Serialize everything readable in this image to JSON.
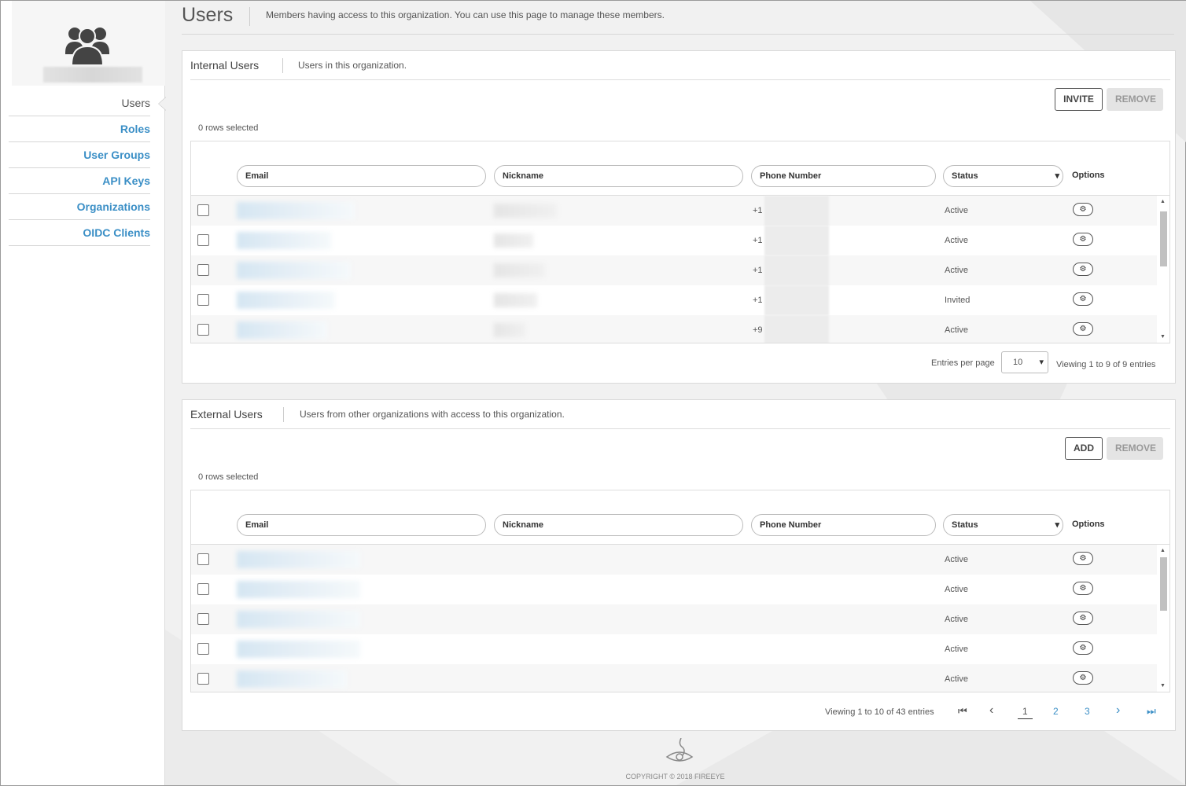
{
  "nav": {
    "items": [
      {
        "label": "Users",
        "active": true
      },
      {
        "label": "Roles"
      },
      {
        "label": "User Groups"
      },
      {
        "label": "API Keys"
      },
      {
        "label": "Organizations"
      },
      {
        "label": "OIDC Clients"
      }
    ]
  },
  "header": {
    "title": "Users",
    "description": "Members having access to this organization. You can use this page to manage these members."
  },
  "internal": {
    "title": "Internal Users",
    "description": "Users in this organization.",
    "invite_label": "INVITE",
    "remove_label": "REMOVE",
    "rows_selected": "0 rows selected",
    "columns": {
      "email": "Email",
      "nickname": "Nickname",
      "phone": "Phone Number",
      "status": "Status",
      "options": "Options"
    },
    "rows": [
      {
        "phone_prefix": "+1",
        "status": "Active"
      },
      {
        "phone_prefix": "+1",
        "status": "Active"
      },
      {
        "phone_prefix": "+1",
        "status": "Active"
      },
      {
        "phone_prefix": "+1",
        "status": "Invited"
      },
      {
        "phone_prefix": "+9",
        "status": "Active"
      }
    ],
    "entries_per_page_label": "Entries per page",
    "entries_per_page_value": "10",
    "viewing": "Viewing 1 to 9 of 9 entries"
  },
  "external": {
    "title": "External Users",
    "description": "Users from other organizations with access to this organization.",
    "add_label": "ADD",
    "remove_label": "REMOVE",
    "rows_selected": "0 rows selected",
    "columns": {
      "email": "Email",
      "nickname": "Nickname",
      "phone": "Phone Number",
      "status": "Status",
      "options": "Options"
    },
    "rows": [
      {
        "status": "Active"
      },
      {
        "status": "Active"
      },
      {
        "status": "Active"
      },
      {
        "status": "Active"
      },
      {
        "status": "Active"
      }
    ],
    "viewing": "Viewing 1 to 10 of 43 entries",
    "pages": [
      "1",
      "2",
      "3"
    ],
    "current_page": "1"
  },
  "footer": {
    "copyright": "COPYRIGHT © 2018 FIREEYE"
  },
  "icons": {
    "org": "users-group-icon",
    "gear": "gear-icon",
    "first": "first-page-icon",
    "prev": "chevron-left-icon",
    "next": "chevron-right-icon",
    "last": "last-page-icon",
    "logo": "fireeye-logo-icon"
  },
  "colors": {
    "link": "#3b8fc6",
    "background": "#f1f1f1"
  }
}
